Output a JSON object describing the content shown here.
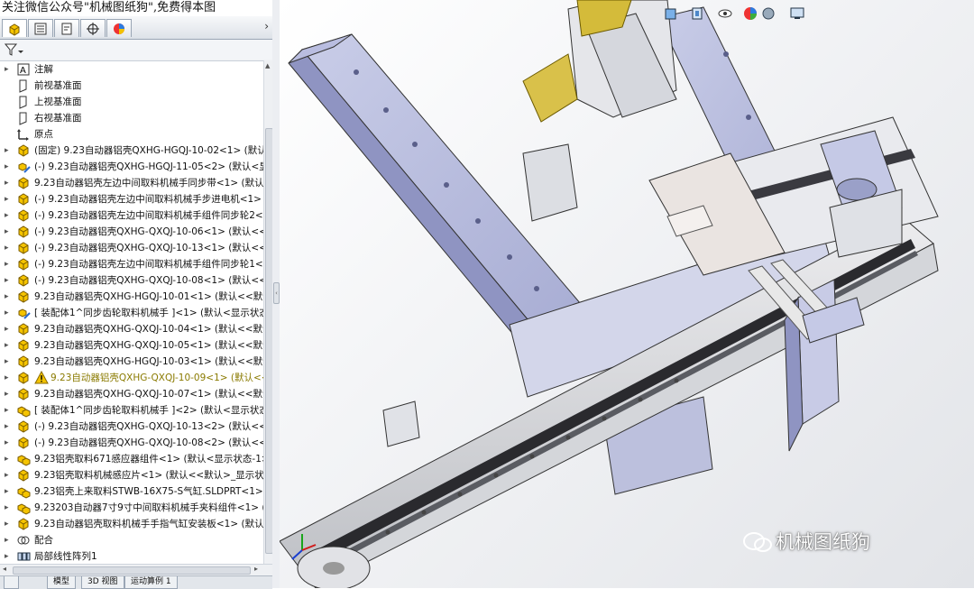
{
  "watermark": "关注微信公众号\"机械图纸狗\",免费得本图",
  "tabs": [
    {
      "name": "feature-manager",
      "icon": "assembly-tree-icon"
    },
    {
      "name": "property-manager",
      "icon": "property-list-icon"
    },
    {
      "name": "configuration-manager",
      "icon": "configuration-icon"
    },
    {
      "name": "dimxpert-manager",
      "icon": "crosshair-icon"
    },
    {
      "name": "display-manager",
      "icon": "display-pie-icon"
    }
  ],
  "tabs_more": "›",
  "tree": {
    "items": [
      {
        "exp": "▸",
        "icon": "annotation-icon",
        "label": "注解"
      },
      {
        "exp": "",
        "icon": "plane-icon",
        "label": "前视基准面"
      },
      {
        "exp": "",
        "icon": "plane-icon",
        "label": "上视基准面"
      },
      {
        "exp": "",
        "icon": "plane-icon",
        "label": "右视基准面"
      },
      {
        "exp": "",
        "icon": "origin-icon",
        "label": "原点"
      },
      {
        "exp": "▸",
        "icon": "part-icon",
        "label": "(固定) 9.23自动器铝壳QXHG-HGQJ-10-02<1> (默认<<默"
      },
      {
        "exp": "▸",
        "icon": "subassembly-edit-icon",
        "label": "(-) 9.23自动器铝壳QXHG-HGQJ-11-05<2> (默认<显示状"
      },
      {
        "exp": "▸",
        "icon": "part-icon",
        "label": "9.23自动器铝壳左边中间取料机械手同步带<1> (默认<<默"
      },
      {
        "exp": "▸",
        "icon": "part-icon",
        "label": "(-) 9.23自动器铝壳左边中间取料机械手步进电机<1> (默认"
      },
      {
        "exp": "▸",
        "icon": "part-icon",
        "label": "(-) 9.23自动器铝壳左边中间取料机械手组件同步轮2<1> (默"
      },
      {
        "exp": "▸",
        "icon": "part-icon",
        "label": "(-) 9.23自动器铝壳QXHG-QXQJ-10-06<1> (默认<<默认"
      },
      {
        "exp": "▸",
        "icon": "part-icon",
        "label": "(-) 9.23自动器铝壳QXHG-QXQJ-10-13<1> (默认<<默认"
      },
      {
        "exp": "▸",
        "icon": "part-icon",
        "label": "(-) 9.23自动器铝壳左边中间取料机械手组件同步轮1<1> (默"
      },
      {
        "exp": "▸",
        "icon": "part-icon",
        "label": "(-) 9.23自动器铝壳QXHG-QXQJ-10-08<1> (默认<<默认"
      },
      {
        "exp": "▸",
        "icon": "part-icon",
        "label": "9.23自动器铝壳QXHG-HGQJ-10-01<1> (默认<<默认>_"
      },
      {
        "exp": "▸",
        "icon": "subassembly-edit-icon",
        "label": "[ 装配体1^同步齿轮取料机械手 ]<1> (默认<显示状态-1>"
      },
      {
        "exp": "▸",
        "icon": "part-icon",
        "label": "9.23自动器铝壳QXHG-QXQJ-10-04<1> (默认<<默认>_"
      },
      {
        "exp": "▸",
        "icon": "part-icon",
        "label": "9.23自动器铝壳QXHG-QXQJ-10-05<1> (默认<<默认>_"
      },
      {
        "exp": "▸",
        "icon": "part-icon",
        "label": "9.23自动器铝壳QXHG-HGQJ-10-03<1> (默认<<默认>_"
      },
      {
        "exp": "▸",
        "icon": "part-icon",
        "label": "9.23自动器铝壳QXHG-QXQJ-10-09<1> (默认<<默认",
        "warn": true
      },
      {
        "exp": "▸",
        "icon": "part-icon",
        "label": "9.23自动器铝壳QXHG-QXQJ-10-07<1> (默认<<默认>_"
      },
      {
        "exp": "▸",
        "icon": "subassembly-icon",
        "label": "[ 装配体1^同步齿轮取料机械手 ]<2> (默认<显示状态-1>"
      },
      {
        "exp": "▸",
        "icon": "part-icon",
        "label": "(-) 9.23自动器铝壳QXHG-QXQJ-10-13<2> (默认<<默认"
      },
      {
        "exp": "▸",
        "icon": "part-icon",
        "label": "(-) 9.23自动器铝壳QXHG-QXQJ-10-08<2> (默认<<默认"
      },
      {
        "exp": "▸",
        "icon": "subassembly-icon",
        "label": "9.23铝壳取料671感应器组件<1> (默认<显示状态-1>)"
      },
      {
        "exp": "▸",
        "icon": "part-icon",
        "label": "9.23铝壳取料机械感应片<1> (默认<<默认>_显示状态 1>"
      },
      {
        "exp": "▸",
        "icon": "subassembly-icon",
        "label": "9.23铝壳上来取料STWB-16X75-S气缸.SLDPRT<1> (默认"
      },
      {
        "exp": "▸",
        "icon": "subassembly-icon",
        "label": "9.23203自动器7寸9寸中间取料机械手夹料组件<1> (默认"
      },
      {
        "exp": "▸",
        "icon": "part-icon",
        "label": "9.23自动器铝壳取料机械手手指气缸安装板<1> (默认<<默"
      },
      {
        "exp": "▸",
        "icon": "mate-icon",
        "label": "配合"
      },
      {
        "exp": "▸",
        "icon": "linear-pattern-icon",
        "label": "局部线性阵列1"
      }
    ]
  },
  "bottom_tabs": [
    "模型",
    "3D 视图",
    "运动算例 1"
  ],
  "brand": "机械图纸狗",
  "colors": {
    "accent": "#2f6fd0",
    "warning": "#e5b800",
    "part_yellow": "#f2c200"
  }
}
